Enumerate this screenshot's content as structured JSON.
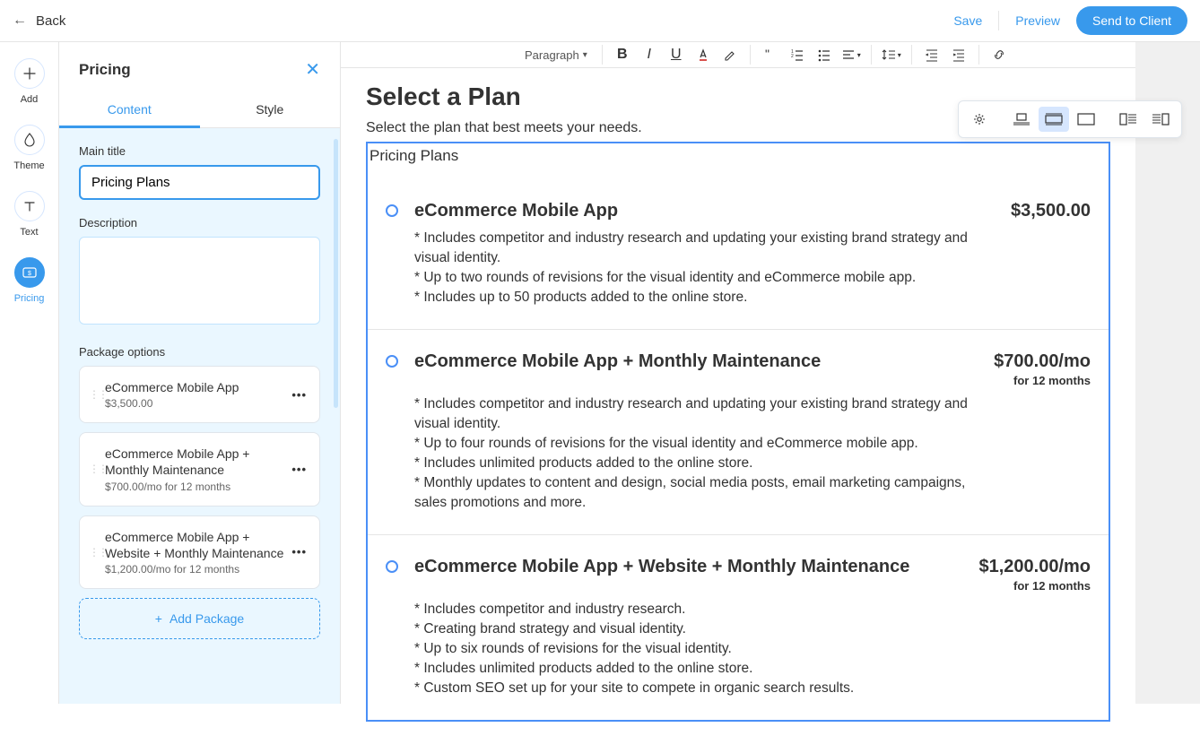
{
  "topbar": {
    "back_label": "Back",
    "save_label": "Save",
    "preview_label": "Preview",
    "send_label": "Send to Client"
  },
  "rail": {
    "items": [
      {
        "label": "Add",
        "icon": "plus-icon"
      },
      {
        "label": "Theme",
        "icon": "droplet-icon"
      },
      {
        "label": "Text",
        "icon": "text-icon"
      },
      {
        "label": "Pricing",
        "icon": "pricing-icon"
      }
    ]
  },
  "panel": {
    "title": "Pricing",
    "tabs": {
      "content": "Content",
      "style": "Style"
    },
    "fields": {
      "main_title_label": "Main title",
      "main_title_value": "Pricing Plans",
      "description_label": "Description",
      "description_value": "",
      "package_options_label": "Package options",
      "add_package_label": "Add Package"
    },
    "packages": [
      {
        "name": "eCommerce Mobile App",
        "price": "$3,500.00"
      },
      {
        "name": "eCommerce Mobile App + Monthly Maintenance",
        "price": "$700.00/mo for 12 months"
      },
      {
        "name": "eCommerce Mobile App + Website + Monthly Maintenance",
        "price": "$1,200.00/mo for 12 months"
      }
    ]
  },
  "editor_toolbar": {
    "paragraph_label": "Paragraph"
  },
  "doc": {
    "heading": "Select a Plan",
    "subheading": "Select the plan that best meets your needs.",
    "block_title": "Pricing Plans",
    "plans": [
      {
        "name": "eCommerce Mobile App",
        "price": "$3,500.00",
        "term": "",
        "bullets": [
          "* Includes competitor and industry research and updating your existing brand strategy and visual identity.",
          "* Up to two rounds of revisions for the visual identity and eCommerce mobile app.",
          "* Includes up to 50 products added to the online store."
        ]
      },
      {
        "name": "eCommerce Mobile App + Monthly Maintenance",
        "price": "$700.00/mo",
        "term": "for 12 months",
        "bullets": [
          "* Includes competitor and industry research and updating your existing brand strategy and visual identity.",
          "* Up to four rounds of revisions for the visual identity and eCommerce mobile app.",
          "* Includes unlimited products added to the online store.",
          "* Monthly updates to content and design, social media posts, email marketing campaigns, sales promotions and more."
        ]
      },
      {
        "name": "eCommerce Mobile App + Website + Monthly Maintenance",
        "price": "$1,200.00/mo",
        "term": "for 12 months",
        "bullets": [
          "* Includes competitor and industry research.",
          "* Creating brand strategy and visual identity.",
          "* Up to six rounds of revisions for the visual identity.",
          "* Includes unlimited products added to the online store.",
          "* Custom SEO set up for your site to compete in organic search results."
        ]
      }
    ]
  }
}
